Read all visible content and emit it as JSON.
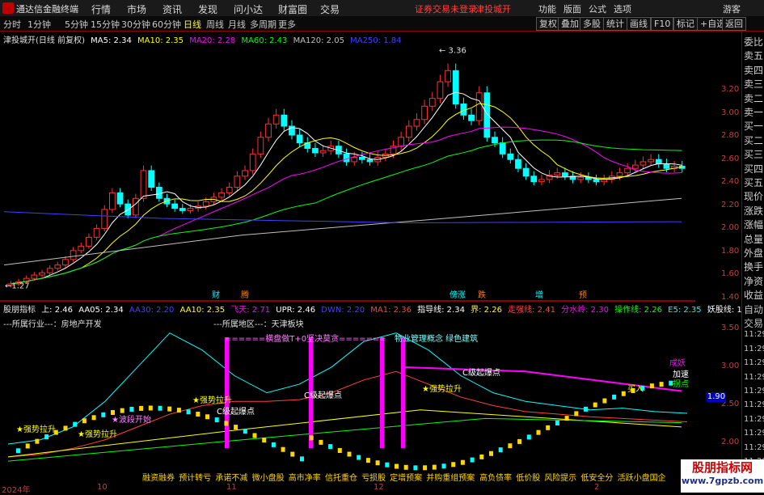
{
  "app": {
    "title": "通达信金融终端",
    "menu": [
      "行情",
      "市场",
      "资讯",
      "发现",
      "问小达",
      "财富圈",
      "交易"
    ],
    "warning": "证券交易未登录",
    "stock_title": "津投城开",
    "right_menu": [
      "功能",
      "版面",
      "公式",
      "选项",
      "游客"
    ]
  },
  "toolbar": {
    "periods": [
      "分时",
      "1分钟",
      "5分钟",
      "15分钟",
      "30分钟",
      "60分钟",
      "日线",
      "周线",
      "月线",
      "多周期",
      "更多"
    ],
    "active_period": "日线",
    "buttons": [
      "复权",
      "叠加",
      "多股",
      "统计",
      "画线",
      "F10",
      "标记",
      "+自选",
      "返回"
    ]
  },
  "main_legend": {
    "name": "津投城开(日线 前复权)",
    "items": [
      {
        "label": "MA5: 2.34",
        "color": "#ffffff"
      },
      {
        "label": "MA10: 2.35",
        "color": "#ffff00"
      },
      {
        "label": "MA20: 2.28",
        "color": "#ff00ff"
      },
      {
        "label": "MA60: 2.43",
        "color": "#00ff00"
      },
      {
        "label": "MA120: 2.05",
        "color": "#c0c0c0"
      },
      {
        "label": "MA250: 1.84",
        "color": "#4040ff"
      }
    ]
  },
  "main_axis": [
    "3.20",
    "3.00",
    "2.80",
    "2.60",
    "2.40",
    "2.20",
    "2.00",
    "1.80",
    "1.60",
    "1.40"
  ],
  "main_marks": {
    "high": "3.36",
    "low": "1.27",
    "tags": [
      "财",
      "腾",
      "傍涨",
      "跌",
      "增",
      "预"
    ]
  },
  "ind_legend": {
    "name": "股朋指标",
    "items": [
      {
        "label": "上: 2.46",
        "color": "#ffffff"
      },
      {
        "label": "AA05: 2.34",
        "color": "#ffffff"
      },
      {
        "label": "AA30: 2.20",
        "color": "#4040ff"
      },
      {
        "label": "AA10: 2.35",
        "color": "#ffff00"
      },
      {
        "label": "飞天: 2.71",
        "color": "#ff00ff"
      },
      {
        "label": "UPR: 2.46",
        "color": "#ffffff"
      },
      {
        "label": "DWN: 2.20",
        "color": "#4040ff"
      },
      {
        "label": "MA1: 2.36",
        "color": "#ff4040"
      },
      {
        "label": "指导线: 2.34",
        "color": "#ffffff"
      },
      {
        "label": "界: 2.26",
        "color": "#ffff00"
      },
      {
        "label": "走强线: 2.41",
        "color": "#ff4040"
      },
      {
        "label": "分水岭: 2.30",
        "color": "#ff00ff"
      },
      {
        "label": "操作线: 2.26",
        "color": "#00ff00"
      },
      {
        "label": "E5: 2.35",
        "color": "#00ffff"
      },
      {
        "label": "妖股线: 1.36",
        "color": "#ffffff"
      }
    ],
    "industry": "---所属行业---：房地产开发",
    "region": "---所属地区---：天津板块",
    "concept": "======横盘做T+0坚决莫贪=======",
    "concept2": "物业管理概念 绿色建筑"
  },
  "ind_axis": [
    "3.50",
    "3.00",
    "2.50",
    "2.00"
  ],
  "ind_current": "1.90",
  "ind_annotations": [
    "C级起爆点",
    "C级起爆点",
    "C级起爆点",
    "★强势拉升",
    "★强势拉升",
    "★波段开始",
    "★强势拉升",
    "★强势拉升",
    "成妖",
    "加速",
    "拐点",
    "买入"
  ],
  "right_panel": [
    "委比",
    "卖五",
    "卖四",
    "卖三",
    "卖二",
    "卖一",
    "买一",
    "买二",
    "买三",
    "买四",
    "买五",
    "现价",
    "涨跌",
    "涨幅",
    "总量",
    "外盘",
    "换手",
    "净资",
    "收益",
    "自动",
    "交易",
    "11:29",
    "11:29",
    "11:29",
    "11:29",
    "11:29",
    "11:29",
    "11:29",
    "11:29",
    "11:29",
    "11:29",
    "11:29"
  ],
  "bottom_tabs": [
    "融资融券",
    "预计转亏",
    "承诺不减",
    "微小盘股",
    "高市净率",
    "信托重仓",
    "亏损股",
    "定增预案",
    "并购重组预案",
    "高负债率",
    "低价股",
    "风险提示",
    "低安全分",
    "活跃小盘国企"
  ],
  "x_axis": [
    "2024年",
    "10",
    "11",
    "12",
    "2"
  ],
  "watermark": {
    "title": "股朋指标网",
    "url": "www.7gpzb.com"
  },
  "chart_data": [
    {
      "type": "candlestick",
      "title": "津投城开(日线 前复权)",
      "ylim": [
        1.2,
        3.45
      ],
      "ma": {
        "MA5": 2.34,
        "MA10": 2.35,
        "MA20": 2.28,
        "MA60": 2.43,
        "MA120": 2.05,
        "MA250": 1.84
      },
      "close": [
        1.28,
        1.3,
        1.33,
        1.36,
        1.38,
        1.42,
        1.45,
        1.5,
        1.58,
        1.62,
        1.7,
        1.78,
        1.95,
        2.1,
        2.0,
        1.9,
        2.05,
        2.3,
        2.15,
        2.05,
        2.0,
        1.96,
        1.94,
        1.96,
        1.98,
        2.02,
        2.06,
        2.1,
        2.15,
        2.25,
        2.3,
        2.45,
        2.6,
        2.72,
        2.8,
        2.7,
        2.62,
        2.55,
        2.5,
        2.46,
        2.48,
        2.52,
        2.45,
        2.38,
        2.42,
        2.4,
        2.38,
        2.42,
        2.45,
        2.52,
        2.6,
        2.7,
        2.76,
        2.88,
        2.95,
        3.1,
        3.2,
        2.9,
        2.8,
        2.75,
        3.0,
        2.6,
        2.55,
        2.45,
        2.4,
        2.32,
        2.25,
        2.2,
        2.22,
        2.26,
        2.28,
        2.25,
        2.22,
        2.24,
        2.22,
        2.2,
        2.22,
        2.25,
        2.28,
        2.32,
        2.35,
        2.38,
        2.4,
        2.36,
        2.32,
        2.34,
        2.32
      ]
    },
    {
      "type": "line",
      "title": "股朋指标",
      "ylim": [
        1.75,
        3.7
      ],
      "series": [
        {
          "name": "UPR",
          "values": [
            2.1,
            2.15,
            2.3,
            2.6,
            3.0,
            3.4,
            3.2,
            2.9,
            2.7,
            2.8,
            3.0,
            3.3,
            3.4,
            3.2,
            2.9,
            2.7,
            2.6,
            2.55,
            2.5,
            2.52,
            2.48,
            2.46
          ]
        },
        {
          "name": "MA1",
          "values": [
            1.95,
            1.98,
            2.05,
            2.15,
            2.3,
            2.45,
            2.55,
            2.6,
            2.6,
            2.62,
            2.7,
            2.85,
            2.95,
            2.8,
            2.65,
            2.55,
            2.48,
            2.45,
            2.42,
            2.4,
            2.38,
            2.36
          ]
        }
      ]
    }
  ]
}
